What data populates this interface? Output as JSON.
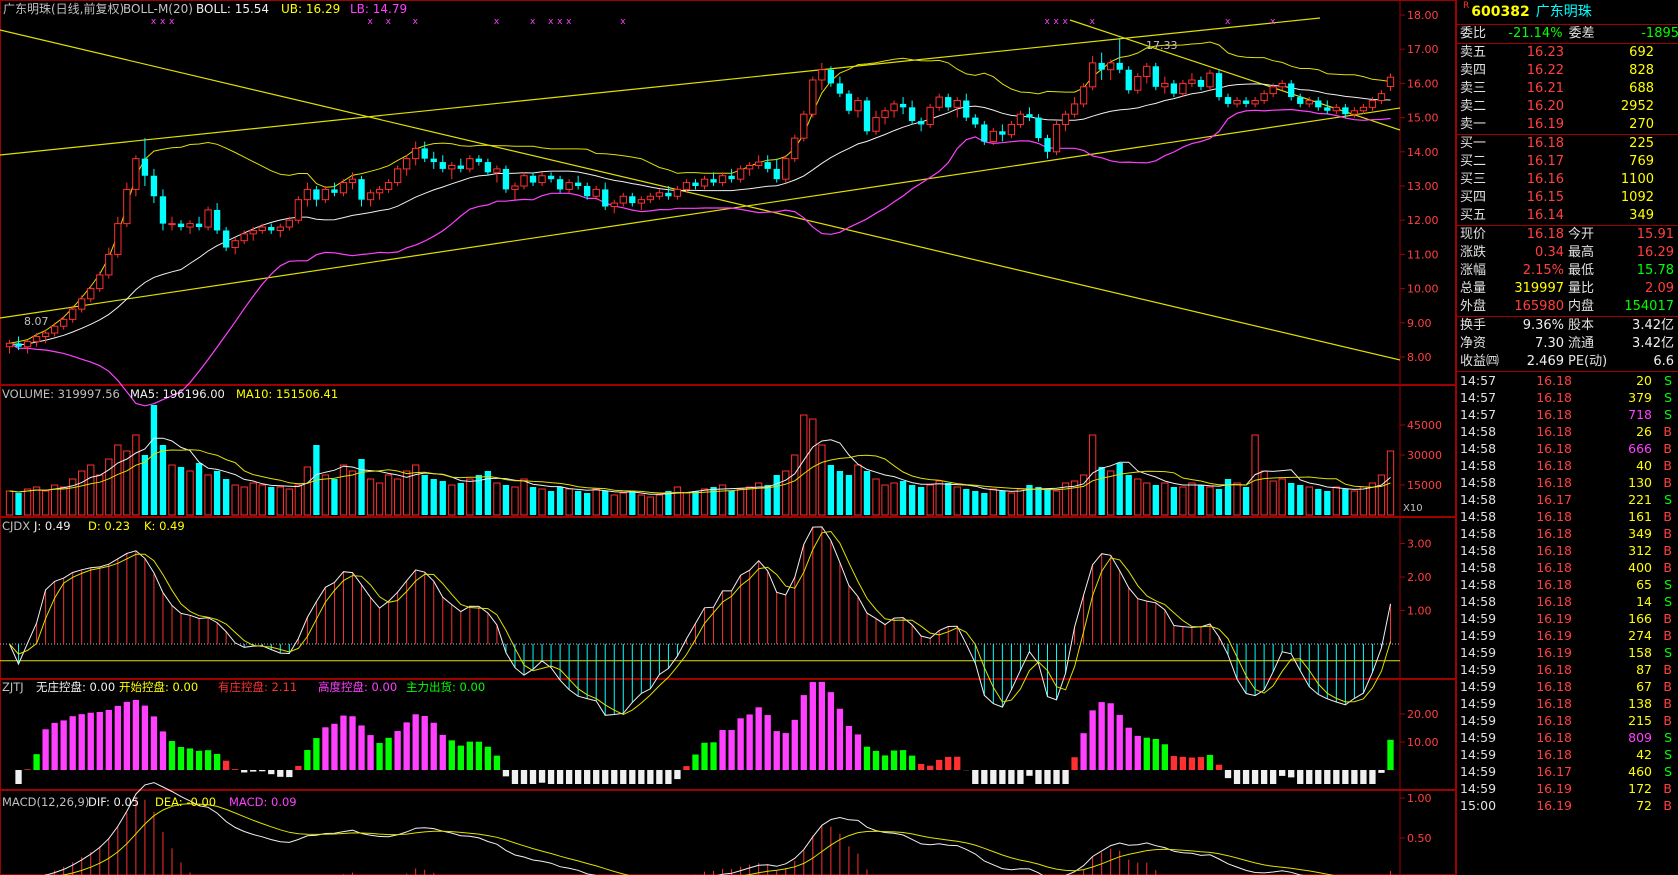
{
  "main_header": {
    "title": "广东明珠(日线,前复权)",
    "boll_name": "BOLL-M(20)",
    "boll_label": "BOLL: 15.54",
    "ub_label": "UB: 16.29",
    "lb_label": "LB: 14.79",
    "peak_label": "17.33",
    "low_label": "8.07"
  },
  "price_axis": [
    "18.00",
    "17.00",
    "16.00",
    "15.00",
    "14.00",
    "13.00",
    "12.00",
    "11.00",
    "10.00",
    "9.00",
    "8.00"
  ],
  "volume_header": {
    "volume": "VOLUME: 319997.56",
    "ma5": "MA5: 196196.00",
    "ma10": "MA10: 151506.41"
  },
  "volume_axis": [
    "45000",
    "30000",
    "15000"
  ],
  "volume_unit": "X10",
  "cjdx_header": {
    "name": "CJDX",
    "j": "J: 0.49",
    "d": "D: 0.23",
    "k": "K: 0.49"
  },
  "cjdx_axis": [
    "3.00",
    "2.00",
    "1.00"
  ],
  "zjtj_header": {
    "name": "ZJTJ",
    "a": "无庄控盘: 0.00",
    "b": "开始控盘: 0.00",
    "c": "有庄控盘: 2.11",
    "d": "高度控盘: 0.00",
    "e": "主力出货: 0.00"
  },
  "zjtj_axis": [
    "20.00",
    "10.00"
  ],
  "macd_header": {
    "name": "MACD(12,26,9)",
    "dif": "DIF: 0.05",
    "dea": "DEA: -0.00",
    "macd": "MACD: 0.09"
  },
  "macd_axis": [
    "1.00",
    "0.50"
  ],
  "quote": {
    "r_mark": "R",
    "code": "600382",
    "name": "广东明珠",
    "weibi_label": "委比",
    "weibi_value": "-21.14%",
    "weicha_label": "委差",
    "weicha_value": "-1895",
    "asks": [
      {
        "label": "卖五",
        "price": "16.23",
        "vol": "692"
      },
      {
        "label": "卖四",
        "price": "16.22",
        "vol": "828"
      },
      {
        "label": "卖三",
        "price": "16.21",
        "vol": "688"
      },
      {
        "label": "卖二",
        "price": "16.20",
        "vol": "2952"
      },
      {
        "label": "卖一",
        "price": "16.19",
        "vol": "270"
      }
    ],
    "bids": [
      {
        "label": "买一",
        "price": "16.18",
        "vol": "225"
      },
      {
        "label": "买二",
        "price": "16.17",
        "vol": "769"
      },
      {
        "label": "买三",
        "price": "16.16",
        "vol": "1100"
      },
      {
        "label": "买四",
        "price": "16.15",
        "vol": "1092"
      },
      {
        "label": "买五",
        "price": "16.14",
        "vol": "349"
      }
    ],
    "stats": [
      {
        "l1": "现价",
        "v1": "16.18",
        "c1": "red",
        "l2": "今开",
        "v2": "15.91",
        "c2": "red"
      },
      {
        "l1": "涨跌",
        "v1": "0.34",
        "c1": "red",
        "l2": "最高",
        "v2": "16.29",
        "c2": "red"
      },
      {
        "l1": "涨幅",
        "v1": "2.15%",
        "c1": "red",
        "l2": "最低",
        "v2": "15.78",
        "c2": "green"
      },
      {
        "l1": "总量",
        "v1": "319997",
        "c1": "yellow",
        "l2": "量比",
        "v2": "2.09",
        "c2": "red"
      },
      {
        "l1": "外盘",
        "v1": "165980",
        "c1": "red",
        "l2": "内盘",
        "v2": "154017",
        "c2": "green"
      }
    ],
    "stats2": [
      {
        "l1": "换手",
        "v1": "9.36%",
        "l2": "股本",
        "v2": "3.42亿"
      },
      {
        "l1": "净资",
        "v1": "7.30",
        "l2": "流通",
        "v2": "3.42亿"
      },
      {
        "l1": "收益㈣",
        "v1": "2.469",
        "l2": "PE(动)",
        "v2": "6.6"
      }
    ],
    "ticks": [
      {
        "t": "14:57",
        "p": "16.18",
        "v": "20",
        "vc": "yellow",
        "bs": "S"
      },
      {
        "t": "14:57",
        "p": "16.18",
        "v": "379",
        "vc": "yellow",
        "bs": "S"
      },
      {
        "t": "14:57",
        "p": "16.18",
        "v": "718",
        "vc": "magenta",
        "bs": "S"
      },
      {
        "t": "14:58",
        "p": "16.18",
        "v": "26",
        "vc": "yellow",
        "bs": "B"
      },
      {
        "t": "14:58",
        "p": "16.18",
        "v": "666",
        "vc": "magenta",
        "bs": "B"
      },
      {
        "t": "14:58",
        "p": "16.18",
        "v": "40",
        "vc": "yellow",
        "bs": "B"
      },
      {
        "t": "14:58",
        "p": "16.18",
        "v": "130",
        "vc": "yellow",
        "bs": "B"
      },
      {
        "t": "14:58",
        "p": "16.17",
        "v": "221",
        "vc": "yellow",
        "bs": "S"
      },
      {
        "t": "14:58",
        "p": "16.18",
        "v": "161",
        "vc": "yellow",
        "bs": "B"
      },
      {
        "t": "14:58",
        "p": "16.18",
        "v": "349",
        "vc": "yellow",
        "bs": "B"
      },
      {
        "t": "14:58",
        "p": "16.18",
        "v": "312",
        "vc": "yellow",
        "bs": "B"
      },
      {
        "t": "14:58",
        "p": "16.18",
        "v": "400",
        "vc": "yellow",
        "bs": "B"
      },
      {
        "t": "14:58",
        "p": "16.18",
        "v": "65",
        "vc": "yellow",
        "bs": "S"
      },
      {
        "t": "14:58",
        "p": "16.18",
        "v": "14",
        "vc": "yellow",
        "bs": "S"
      },
      {
        "t": "14:59",
        "p": "16.19",
        "v": "166",
        "vc": "yellow",
        "bs": "B"
      },
      {
        "t": "14:59",
        "p": "16.19",
        "v": "274",
        "vc": "yellow",
        "bs": "B"
      },
      {
        "t": "14:59",
        "p": "16.19",
        "v": "158",
        "vc": "yellow",
        "bs": "S"
      },
      {
        "t": "14:59",
        "p": "16.18",
        "v": "87",
        "vc": "yellow",
        "bs": "B"
      },
      {
        "t": "14:59",
        "p": "16.18",
        "v": "67",
        "vc": "yellow",
        "bs": "B"
      },
      {
        "t": "14:59",
        "p": "16.18",
        "v": "138",
        "vc": "yellow",
        "bs": "B"
      },
      {
        "t": "14:59",
        "p": "16.18",
        "v": "215",
        "vc": "yellow",
        "bs": "B"
      },
      {
        "t": "14:59",
        "p": "16.18",
        "v": "809",
        "vc": "magenta",
        "bs": "S"
      },
      {
        "t": "14:59",
        "p": "16.18",
        "v": "42",
        "vc": "yellow",
        "bs": "S"
      },
      {
        "t": "14:59",
        "p": "16.17",
        "v": "460",
        "vc": "yellow",
        "bs": "S"
      },
      {
        "t": "14:59",
        "p": "16.19",
        "v": "172",
        "vc": "yellow",
        "bs": "B"
      },
      {
        "t": "15:00",
        "p": "16.19",
        "v": "72",
        "vc": "yellow",
        "bs": "B"
      }
    ]
  },
  "chart_data": {
    "type": "candlestick",
    "ohlc": [
      [
        8.3,
        8.5,
        8.1,
        8.4
      ],
      [
        8.4,
        8.6,
        8.2,
        8.3
      ],
      [
        8.3,
        8.5,
        8.1,
        8.45
      ],
      [
        8.45,
        8.7,
        8.3,
        8.6
      ],
      [
        8.6,
        8.8,
        8.4,
        8.7
      ],
      [
        8.7,
        9.0,
        8.6,
        8.9
      ],
      [
        8.9,
        9.2,
        8.8,
        9.1
      ],
      [
        9.1,
        9.5,
        9.0,
        9.4
      ],
      [
        9.4,
        9.8,
        9.3,
        9.7
      ],
      [
        9.7,
        10.1,
        9.6,
        10.0
      ],
      [
        10.0,
        10.5,
        9.9,
        10.4
      ],
      [
        10.4,
        11.2,
        10.3,
        11.0
      ],
      [
        11.0,
        12.1,
        10.9,
        11.9
      ],
      [
        11.9,
        13.1,
        11.8,
        12.9
      ],
      [
        12.9,
        13.9,
        12.7,
        13.8
      ],
      [
        13.8,
        14.4,
        13.0,
        13.3
      ],
      [
        13.3,
        13.5,
        12.5,
        12.7
      ],
      [
        12.7,
        12.9,
        11.7,
        11.9
      ],
      [
        11.9,
        12.1,
        11.7,
        11.9
      ],
      [
        11.9,
        12.0,
        11.7,
        11.8
      ],
      [
        11.8,
        12.0,
        11.6,
        11.9
      ],
      [
        11.9,
        12.1,
        11.7,
        11.8
      ],
      [
        11.8,
        12.4,
        11.7,
        12.3
      ],
      [
        12.3,
        12.5,
        11.6,
        11.7
      ],
      [
        11.7,
        11.8,
        11.1,
        11.2
      ],
      [
        11.2,
        11.5,
        11.0,
        11.4
      ],
      [
        11.4,
        11.7,
        11.3,
        11.6
      ],
      [
        11.6,
        11.8,
        11.4,
        11.7
      ],
      [
        11.7,
        11.9,
        11.6,
        11.8
      ],
      [
        11.8,
        11.9,
        11.6,
        11.7
      ],
      [
        11.7,
        11.9,
        11.5,
        11.8
      ],
      [
        11.8,
        12.1,
        11.7,
        12.0
      ],
      [
        12.0,
        12.7,
        11.9,
        12.6
      ],
      [
        12.6,
        13.1,
        12.4,
        12.9
      ],
      [
        12.9,
        13.0,
        12.4,
        12.6
      ],
      [
        12.6,
        13.0,
        12.5,
        12.9
      ],
      [
        12.9,
        13.1,
        12.7,
        12.8
      ],
      [
        12.8,
        13.2,
        12.7,
        13.1
      ],
      [
        13.1,
        13.4,
        12.9,
        13.2
      ],
      [
        13.2,
        13.3,
        12.4,
        12.6
      ],
      [
        12.6,
        12.9,
        12.4,
        12.8
      ],
      [
        12.8,
        13.0,
        12.6,
        12.9
      ],
      [
        12.9,
        13.2,
        12.8,
        13.1
      ],
      [
        13.1,
        13.6,
        13.0,
        13.5
      ],
      [
        13.5,
        13.9,
        13.3,
        13.8
      ],
      [
        13.8,
        14.3,
        13.6,
        14.1
      ],
      [
        14.1,
        14.3,
        13.7,
        13.8
      ],
      [
        13.8,
        14.0,
        13.5,
        13.7
      ],
      [
        13.7,
        13.9,
        13.4,
        13.5
      ],
      [
        13.5,
        13.7,
        13.2,
        13.6
      ],
      [
        13.6,
        13.8,
        13.4,
        13.5
      ],
      [
        13.5,
        13.9,
        13.4,
        13.8
      ],
      [
        13.8,
        13.9,
        13.6,
        13.7
      ],
      [
        13.7,
        13.8,
        13.3,
        13.4
      ],
      [
        13.4,
        13.6,
        13.1,
        13.5
      ],
      [
        13.5,
        13.6,
        12.8,
        12.9
      ],
      [
        12.9,
        13.1,
        12.6,
        13.0
      ],
      [
        13.0,
        13.4,
        12.9,
        13.3
      ],
      [
        13.3,
        13.4,
        13.0,
        13.1
      ],
      [
        13.1,
        13.4,
        13.0,
        13.3
      ],
      [
        13.3,
        13.4,
        13.1,
        13.2
      ],
      [
        13.2,
        13.3,
        12.8,
        12.9
      ],
      [
        12.9,
        13.2,
        12.8,
        13.1
      ],
      [
        13.1,
        13.3,
        12.9,
        13.0
      ],
      [
        13.0,
        13.1,
        12.6,
        12.7
      ],
      [
        12.7,
        13.0,
        12.6,
        12.9
      ],
      [
        12.9,
        13.1,
        12.3,
        12.4
      ],
      [
        12.4,
        12.6,
        12.2,
        12.5
      ],
      [
        12.5,
        12.8,
        12.4,
        12.7
      ],
      [
        12.7,
        12.8,
        12.4,
        12.5
      ],
      [
        12.5,
        12.7,
        12.3,
        12.6
      ],
      [
        12.6,
        12.8,
        12.5,
        12.7
      ],
      [
        12.7,
        12.9,
        12.6,
        12.8
      ],
      [
        12.8,
        13.0,
        12.6,
        12.7
      ],
      [
        12.7,
        13.0,
        12.6,
        12.9
      ],
      [
        12.9,
        13.2,
        12.8,
        13.1
      ],
      [
        13.1,
        13.2,
        12.9,
        13.0
      ],
      [
        13.0,
        13.3,
        12.9,
        13.2
      ],
      [
        13.2,
        13.4,
        13.0,
        13.1
      ],
      [
        13.1,
        13.4,
        13.0,
        13.3
      ],
      [
        13.3,
        13.5,
        13.1,
        13.2
      ],
      [
        13.2,
        13.6,
        13.1,
        13.5
      ],
      [
        13.5,
        13.7,
        13.3,
        13.6
      ],
      [
        13.6,
        13.9,
        13.5,
        13.7
      ],
      [
        13.7,
        13.9,
        13.4,
        13.5
      ],
      [
        13.5,
        13.8,
        13.1,
        13.2
      ],
      [
        13.2,
        13.9,
        13.1,
        13.8
      ],
      [
        13.8,
        14.5,
        13.7,
        14.4
      ],
      [
        14.4,
        15.2,
        14.3,
        15.1
      ],
      [
        15.1,
        16.2,
        15.0,
        16.1
      ],
      [
        16.1,
        16.6,
        15.8,
        16.4
      ],
      [
        16.4,
        16.5,
        15.9,
        16.0
      ],
      [
        16.0,
        16.2,
        15.6,
        15.7
      ],
      [
        15.7,
        15.8,
        15.1,
        15.2
      ],
      [
        15.2,
        15.6,
        15.0,
        15.5
      ],
      [
        15.5,
        15.6,
        14.5,
        14.6
      ],
      [
        14.6,
        15.2,
        14.5,
        15.0
      ],
      [
        15.0,
        15.3,
        14.8,
        15.2
      ],
      [
        15.2,
        15.5,
        15.0,
        15.4
      ],
      [
        15.4,
        15.6,
        15.1,
        15.3
      ],
      [
        15.3,
        15.5,
        14.8,
        14.9
      ],
      [
        14.9,
        15.0,
        14.6,
        14.8
      ],
      [
        14.8,
        15.4,
        14.7,
        15.3
      ],
      [
        15.3,
        15.7,
        15.2,
        15.6
      ],
      [
        15.6,
        15.7,
        15.2,
        15.3
      ],
      [
        15.3,
        15.6,
        15.0,
        15.5
      ],
      [
        15.5,
        15.7,
        14.9,
        15.0
      ],
      [
        15.0,
        15.1,
        14.7,
        14.8
      ],
      [
        14.8,
        14.9,
        14.2,
        14.3
      ],
      [
        14.3,
        14.7,
        14.2,
        14.6
      ],
      [
        14.6,
        14.8,
        14.3,
        14.5
      ],
      [
        14.5,
        14.9,
        14.4,
        14.8
      ],
      [
        14.8,
        15.2,
        14.7,
        15.1
      ],
      [
        15.1,
        15.3,
        14.9,
        15.0
      ],
      [
        15.0,
        15.1,
        14.3,
        14.4
      ],
      [
        14.4,
        14.5,
        13.8,
        14.0
      ],
      [
        14.0,
        14.9,
        13.9,
        14.8
      ],
      [
        14.8,
        15.2,
        14.6,
        15.1
      ],
      [
        15.1,
        15.6,
        15.0,
        15.4
      ],
      [
        15.4,
        16.0,
        15.3,
        15.9
      ],
      [
        15.9,
        16.8,
        15.8,
        16.6
      ],
      [
        16.6,
        16.9,
        16.1,
        16.4
      ],
      [
        16.4,
        16.7,
        16.1,
        16.6
      ],
      [
        16.6,
        17.33,
        16.3,
        16.4
      ],
      [
        16.4,
        16.5,
        15.7,
        15.8
      ],
      [
        15.8,
        16.3,
        15.7,
        16.2
      ],
      [
        16.2,
        16.6,
        16.0,
        16.5
      ],
      [
        16.5,
        16.6,
        15.8,
        15.9
      ],
      [
        15.9,
        16.2,
        15.7,
        16.0
      ],
      [
        16.0,
        16.1,
        15.6,
        15.7
      ],
      [
        15.7,
        16.1,
        15.6,
        16.0
      ],
      [
        16.0,
        16.3,
        15.9,
        16.1
      ],
      [
        16.1,
        16.2,
        15.8,
        15.9
      ],
      [
        15.9,
        16.4,
        15.8,
        16.3
      ],
      [
        16.3,
        16.4,
        15.5,
        15.6
      ],
      [
        15.6,
        15.7,
        15.3,
        15.4
      ],
      [
        15.4,
        15.6,
        15.3,
        15.5
      ],
      [
        15.5,
        15.6,
        15.3,
        15.4
      ],
      [
        15.4,
        15.6,
        15.3,
        15.5
      ],
      [
        15.5,
        15.8,
        15.4,
        15.7
      ],
      [
        15.7,
        16.0,
        15.6,
        15.9
      ],
      [
        15.9,
        16.1,
        15.8,
        16.0
      ],
      [
        16.0,
        16.1,
        15.5,
        15.6
      ],
      [
        15.6,
        15.7,
        15.3,
        15.4
      ],
      [
        15.4,
        15.6,
        15.3,
        15.5
      ],
      [
        15.5,
        15.6,
        15.2,
        15.3
      ],
      [
        15.3,
        15.5,
        15.1,
        15.2
      ],
      [
        15.2,
        15.4,
        15.1,
        15.3
      ],
      [
        15.3,
        15.4,
        15.0,
        15.1
      ],
      [
        15.1,
        15.3,
        15.0,
        15.2
      ],
      [
        15.2,
        15.4,
        15.1,
        15.3
      ],
      [
        15.3,
        15.6,
        15.2,
        15.5
      ],
      [
        15.5,
        15.8,
        15.4,
        15.7
      ],
      [
        15.91,
        16.29,
        15.78,
        16.18
      ]
    ],
    "volume": [
      12000,
      11000,
      13000,
      14000,
      12000,
      15000,
      14000,
      18000,
      22000,
      25000,
      20000,
      28000,
      35000,
      32000,
      40000,
      30000,
      55000,
      35000,
      25000,
      24000,
      22000,
      26000,
      20000,
      22000,
      18000,
      15000,
      14000,
      16000,
      15000,
      14000,
      14000,
      13000,
      15000,
      24000,
      35000,
      20000,
      18000,
      25000,
      22000,
      28000,
      18000,
      16000,
      20000,
      18000,
      22000,
      25000,
      20000,
      18000,
      17000,
      15000,
      16000,
      18000,
      20000,
      22000,
      16000,
      15000,
      14000,
      18000,
      14000,
      13000,
      12000,
      14000,
      13000,
      12000,
      11000,
      13000,
      12000,
      10000,
      11000,
      12000,
      10000,
      9000,
      10000,
      12000,
      14000,
      11000,
      12000,
      13000,
      14000,
      15000,
      12000,
      13000,
      14000,
      16000,
      15000,
      20000,
      22000,
      30000,
      50000,
      48000,
      35000,
      25000,
      22000,
      20000,
      25000,
      22000,
      18000,
      15000,
      16000,
      17000,
      15000,
      14000,
      15000,
      17000,
      16000,
      14000,
      13000,
      12000,
      11000,
      13000,
      12000,
      11000,
      13000,
      15000,
      14000,
      13000,
      12000,
      16000,
      17000,
      20000,
      40000,
      24000,
      22000,
      26000,
      20000,
      18000,
      16000,
      15000,
      16000,
      14000,
      14000,
      16000,
      15000,
      14000,
      13000,
      18000,
      16000,
      14000,
      40000,
      22000,
      17000,
      18000,
      16000,
      15000,
      14000,
      13000,
      12000,
      14000,
      13000,
      12000,
      14000,
      16000,
      20000,
      32000
    ]
  }
}
